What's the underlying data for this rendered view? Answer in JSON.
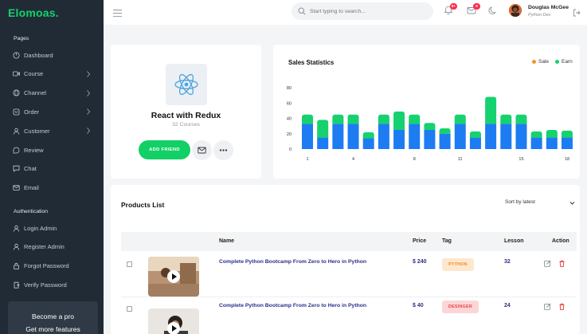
{
  "app": {
    "logo": "Elomoas."
  },
  "sidebar": {
    "sections": [
      {
        "title": "Pages"
      },
      {
        "title": "Authentication"
      }
    ],
    "pages": [
      {
        "label": "Dashboard",
        "icon": "dashboard-icon",
        "chevron": false
      },
      {
        "label": "Course",
        "icon": "video-icon",
        "chevron": true
      },
      {
        "label": "Channel",
        "icon": "globe-icon",
        "chevron": true
      },
      {
        "label": "Order",
        "icon": "cart-icon",
        "chevron": true
      },
      {
        "label": "Customer",
        "icon": "user-icon",
        "chevron": true
      },
      {
        "label": "Review",
        "icon": "review-icon",
        "chevron": false
      },
      {
        "label": "Chat",
        "icon": "chat-icon",
        "chevron": false
      },
      {
        "label": "Email",
        "icon": "mail-icon",
        "chevron": false
      }
    ],
    "auth": [
      {
        "label": "Login Admin",
        "icon": "login-icon"
      },
      {
        "label": "Register Admin",
        "icon": "register-icon"
      },
      {
        "label": "Forgot Password",
        "icon": "lock-icon"
      },
      {
        "label": "Verify Password",
        "icon": "verify-icon"
      }
    ],
    "promo": {
      "line1": "Become a pro",
      "line2": "Get more features"
    }
  },
  "header": {
    "search_placeholder": "Start typing to search...",
    "notifications_badge": "9+",
    "mail_badge": "9",
    "user": {
      "name": "Douglas McGee",
      "role": "Python Dev"
    }
  },
  "profile_card": {
    "title": "React with Redux",
    "subtitle": "32 Courses",
    "add_friend_label": "ADD FRIEND"
  },
  "sales": {
    "title": "Sales Statistics",
    "legend": [
      {
        "label": "Sale",
        "color": "#f59322"
      },
      {
        "label": "Earn",
        "color": "#15d26e"
      }
    ]
  },
  "chart_data": {
    "type": "bar",
    "stacked": true,
    "x": [
      1,
      2,
      3,
      4,
      5,
      6,
      7,
      8,
      9,
      10,
      11,
      12,
      13,
      14,
      15,
      16,
      17,
      18
    ],
    "x_tick_labels": [
      "1",
      "4",
      "8",
      "11",
      "15",
      "18"
    ],
    "x_tick_positions": [
      1,
      4,
      8,
      11,
      15,
      18
    ],
    "series": [
      {
        "name": "Sale",
        "color": "#1e7cf2",
        "values": [
          33,
          15,
          33,
          33,
          14,
          33,
          25,
          33,
          25,
          20,
          33,
          15,
          33,
          33,
          33,
          15,
          15,
          15
        ]
      },
      {
        "name": "Earn",
        "color": "#15d26e",
        "values": [
          12,
          23,
          12,
          12,
          8,
          12,
          24,
          12,
          9,
          7,
          12,
          8,
          35,
          12,
          12,
          8,
          10,
          9
        ]
      }
    ],
    "ylim": [
      0,
      80
    ],
    "y_ticks": [
      0,
      20,
      40,
      60,
      80
    ],
    "colors": {
      "bottom": "#1e7cf2",
      "top": "#15d26e"
    }
  },
  "products": {
    "title": "Products List",
    "sort_label": "Sort by latest",
    "columns": {
      "name": "Name",
      "price": "Price",
      "tag": "Tag",
      "lesson": "Lesson",
      "action": "Action"
    },
    "rows": [
      {
        "name": "Complete Python Bootcamp From Zero to Hero in Python",
        "price": "$ 240",
        "tag": "PYTHON",
        "tag_bg": "#fde7cf",
        "tag_fg": "#f08a24",
        "lesson": "32"
      },
      {
        "name": "Complete Python Bootcamp From Zero to Hero in Python",
        "price": "$ 40",
        "tag": "DESINGER",
        "tag_bg": "#fcd6d6",
        "tag_fg": "#e8424a",
        "lesson": "24"
      }
    ]
  }
}
